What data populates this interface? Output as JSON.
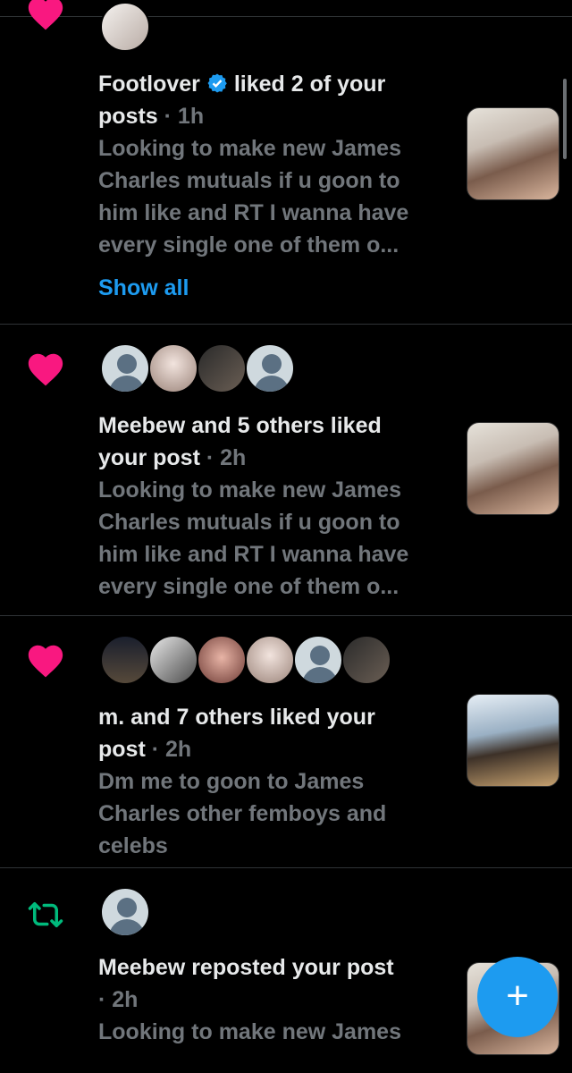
{
  "notifications": [
    {
      "type": "like",
      "actor": "Footlover",
      "verified": true,
      "action": "liked 2 of your",
      "action2": "posts",
      "time": "· 1h",
      "snippet": [
        "Looking to make new James",
        "Charles mutuals if u goon to",
        "him like and RT I wanna have",
        "every single one of them o..."
      ],
      "show_all": "Show all"
    },
    {
      "type": "like",
      "line1": "Meebew and 5 others liked",
      "line2": "your post",
      "time": "· 2h",
      "snippet": [
        "Looking to make new James",
        "Charles mutuals if u goon to",
        "him like and RT I wanna have",
        "every single one of them o..."
      ]
    },
    {
      "type": "like",
      "line1": "m. and 7 others liked your",
      "line2": "post",
      "time": "· 2h",
      "snippet": [
        "Dm me to goon to James",
        "Charles other femboys and",
        "celebs"
      ]
    },
    {
      "type": "repost",
      "line1": "Meebew reposted your post",
      "time": "· 2h",
      "snippet": [
        "Looking to make new James"
      ]
    }
  ],
  "fab": {
    "label": "+"
  },
  "colors": {
    "like": "#f91880",
    "repost": "#00ba7c",
    "accent": "#1d9bf0"
  }
}
